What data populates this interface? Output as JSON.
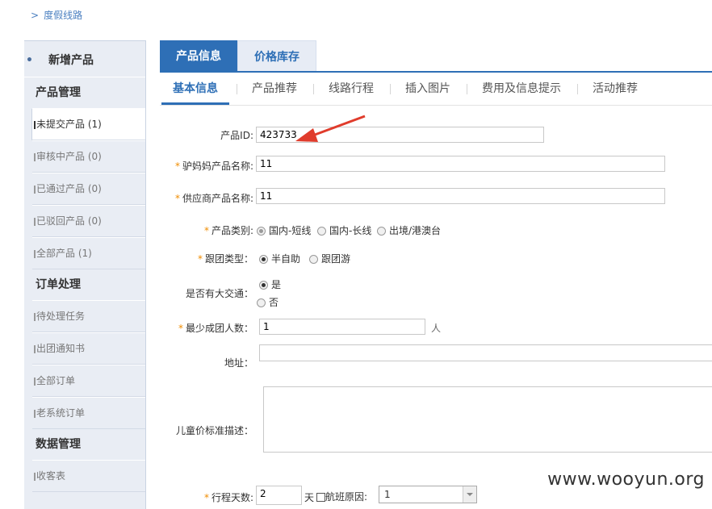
{
  "breadcrumb": {
    "label": "度假线路"
  },
  "sidebar": {
    "new_product": "新增产品",
    "sections": [
      {
        "title": "产品管理",
        "items": [
          "未提交产品 (1)",
          "审核中产品 (0)",
          "已通过产品 (0)",
          "已驳回产品 (0)",
          "全部产品 (1)"
        ]
      },
      {
        "title": "订单处理",
        "items": [
          "待处理任务",
          "出团通知书",
          "全部订单",
          "老系统订单"
        ]
      },
      {
        "title": "数据管理",
        "items": [
          "收客表"
        ]
      }
    ]
  },
  "tabs": [
    "产品信息",
    "价格库存"
  ],
  "subtabs": [
    "基本信息",
    "产品推荐",
    "线路行程",
    "插入图片",
    "费用及信息提示",
    "活动推荐"
  ],
  "form": {
    "product_id_label": "产品ID:",
    "product_id_value": "423733",
    "lvmama_name_label": "驴妈妈产品名称:",
    "lvmama_name_value": "11",
    "supplier_name_label": "供应商产品名称:",
    "supplier_name_value": "11",
    "category_label": "产品类别:",
    "category_options": [
      "国内-短线",
      "国内-长线",
      "出境/港澳台"
    ],
    "tour_type_label": "跟团类型：",
    "tour_type_options": [
      "半自助",
      "跟团游"
    ],
    "transport_label": "是否有大交通：",
    "transport_options": [
      "是",
      "否"
    ],
    "min_people_label": "最少成团人数：",
    "min_people_value": "1",
    "min_people_unit": "人",
    "address_label": "地址：",
    "child_price_label": "儿童价标准描述：",
    "days_label": "行程天数:",
    "days_value": "2",
    "days_unit": "天",
    "flight_label": "航班原因:",
    "flight_value": "1"
  },
  "watermark": "www.wooyun.org",
  "colors": {
    "accent": "#2e6fb6",
    "arrow": "#e03c2c",
    "required": "#f08c00"
  }
}
